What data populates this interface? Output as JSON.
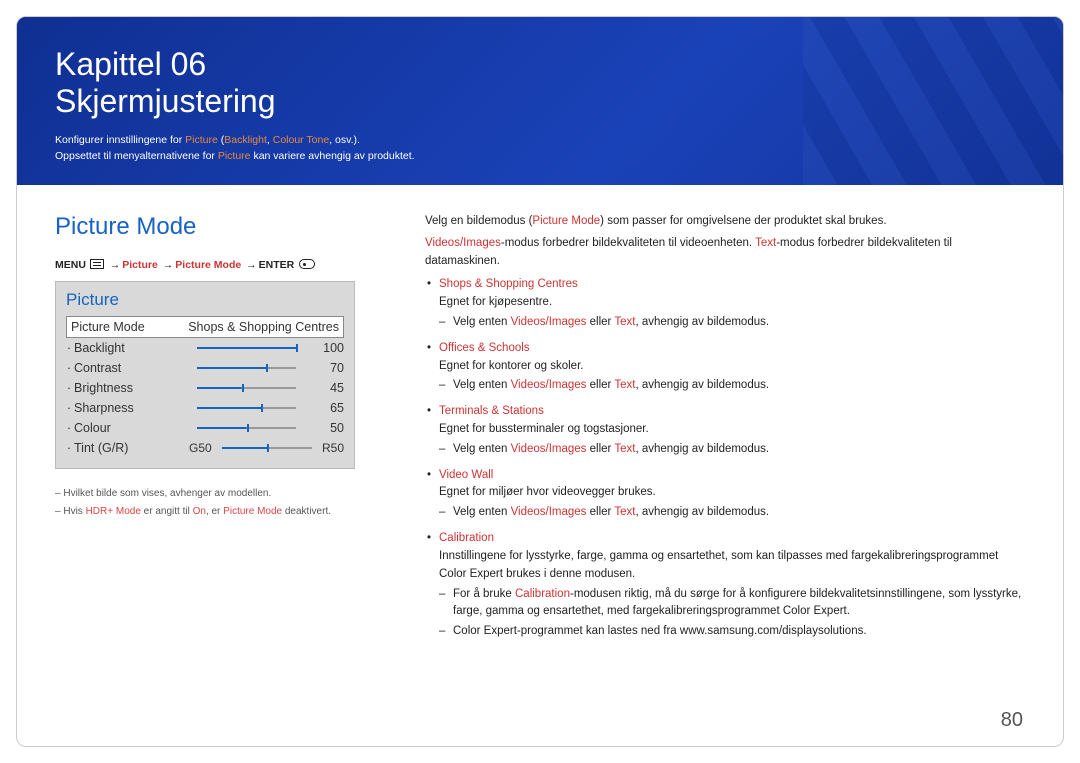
{
  "hero": {
    "chapter": "Kapittel 06",
    "title": "Skjermjustering",
    "desc1_pre": "Konfigurer innstillingene for ",
    "desc1_pic": "Picture",
    "desc1_mid": " (",
    "desc1_b": "Backlight",
    "desc1_c": ", ",
    "desc1_ct": "Colour Tone",
    "desc1_end": ", osv.).",
    "desc2_pre": "Oppsettet til menyalternativene for ",
    "desc2_pic": "Picture",
    "desc2_end": " kan variere avhengig av produktet."
  },
  "left": {
    "section_title": "Picture Mode",
    "menu_label": "MENU",
    "arrow": "→",
    "path_picture": "Picture",
    "path_pm": "Picture Mode",
    "enter": "ENTER",
    "osd": {
      "title": "Picture",
      "selected_label": "Picture Mode",
      "selected_value": "Shops & Shopping Centres",
      "rows": [
        {
          "label": "Backlight",
          "value": "100",
          "p": "100%"
        },
        {
          "label": "Contrast",
          "value": "70",
          "p": "70%"
        },
        {
          "label": "Brightness",
          "value": "45",
          "p": "45%"
        },
        {
          "label": "Sharpness",
          "value": "65",
          "p": "65%"
        },
        {
          "label": "Colour",
          "value": "50",
          "p": "50%"
        }
      ],
      "tint": {
        "label": "Tint (G/R)",
        "left": "G50",
        "right": "R50",
        "p": "50%"
      }
    },
    "footnotes": {
      "f1": "Hvilket bilde som vises, avhenger av modellen.",
      "f2_pre": "Hvis ",
      "f2_hdr": "HDR+ Mode",
      "f2_mid": " er angitt til ",
      "f2_on": "On",
      "f2_mid2": ", er ",
      "f2_pm": "Picture Mode",
      "f2_end": " deaktivert."
    }
  },
  "right": {
    "p1_pre": "Velg en bildemodus (",
    "p1_pm": "Picture Mode",
    "p1_end": ") som passer for omgivelsene der produktet skal brukes.",
    "p2_vi": "Videos/Images",
    "p2_mid": "-modus forbedrer bildekvaliteten til videoenheten. ",
    "p2_tx": "Text",
    "p2_end": "-modus forbedrer bildekvaliteten til datamaskinen.",
    "items": [
      {
        "title": "Shops & Shopping Centres",
        "line": "Egnet for kjøpesentre.",
        "sub_pre": "Velg enten ",
        "sub_vi": "Videos/Images",
        "sub_mid": " eller ",
        "sub_tx": "Text",
        "sub_end": ", avhengig av bildemodus."
      },
      {
        "title": "Offices & Schools",
        "line": "Egnet for kontorer og skoler.",
        "sub_pre": "Velg enten ",
        "sub_vi": "Videos/Images",
        "sub_mid": " eller ",
        "sub_tx": "Text",
        "sub_end": ", avhengig av bildemodus."
      },
      {
        "title": "Terminals & Stations",
        "line": "Egnet for bussterminaler og togstasjoner.",
        "sub_pre": "Velg enten ",
        "sub_vi": "Videos/Images",
        "sub_mid": " eller ",
        "sub_tx": "Text",
        "sub_end": ", avhengig av bildemodus."
      },
      {
        "title": "Video Wall",
        "line": "Egnet for miljøer hvor videovegger brukes.",
        "sub_pre": "Velg enten ",
        "sub_vi": "Videos/Images",
        "sub_mid": " eller ",
        "sub_tx": "Text",
        "sub_end": ", avhengig av bildemodus."
      }
    ],
    "calibration": {
      "title": "Calibration",
      "line": "Innstillingene for lysstyrke, farge, gamma og ensartethet, som kan tilpasses med fargekalibreringsprogrammet Color Expert brukes i denne modusen.",
      "sub1_pre": "For å bruke ",
      "sub1_cal": "Calibration",
      "sub1_end": "-modusen riktig, må du sørge for å konfigurere bildekvalitetsinnstillingene, som lysstyrke, farge, gamma og ensartethet, med fargekalibreringsprogrammet Color Expert.",
      "sub2": "Color Expert-programmet kan lastes ned fra www.samsung.com/displaysolutions."
    }
  },
  "page_number": "80"
}
